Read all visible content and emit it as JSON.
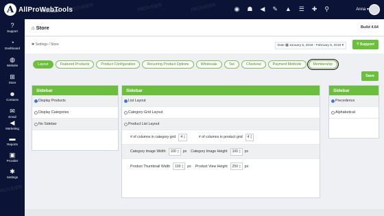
{
  "app": {
    "logo_letter": "A",
    "logo_name": "AllProWebTools",
    "logo_sub": "PROVIDER"
  },
  "watermark": "PROVIDER",
  "user": {
    "name": "Anna"
  },
  "top_icons": [
    "eye-icon",
    "users-icon",
    "megaphone-icon",
    "chat-icon",
    "alert-icon",
    "list-icon",
    "plus-icon",
    "search-icon"
  ],
  "sidebar": {
    "items": [
      {
        "label": "Support",
        "icon": "question-icon",
        "glyph": "?"
      },
      {
        "label": "Dashboard",
        "icon": "dashboard-icon",
        "glyph": "◔"
      },
      {
        "label": "Website",
        "icon": "globe-icon",
        "glyph": "◍"
      },
      {
        "label": "Store",
        "icon": "cart-icon",
        "glyph": "⊞"
      },
      {
        "label": "Contacts",
        "icon": "contacts-icon",
        "glyph": "☻"
      },
      {
        "label": "Email",
        "icon": "email-icon",
        "glyph": "✉"
      },
      {
        "label": "Marketing",
        "icon": "megaphone-icon",
        "glyph": "◀"
      },
      {
        "label": "Reports",
        "icon": "folder-icon",
        "glyph": "▬"
      },
      {
        "label": "Provider",
        "icon": "briefcase-icon",
        "glyph": "▣"
      },
      {
        "label": "Settings",
        "icon": "gear-icon",
        "glyph": "✱"
      }
    ]
  },
  "page": {
    "title": "Store",
    "build": "Build 4.64",
    "breadcrumb_settings": "Settings",
    "breadcrumb_sep": "/",
    "breadcrumb_store": "Store",
    "date_label": "Date",
    "date_range": "January 5, 2019 - February 5, 2019",
    "support_label": "Support",
    "save_label": "Save"
  },
  "tabs": [
    {
      "label": "Layout",
      "active": true
    },
    {
      "label": "Featured Products"
    },
    {
      "label": "Product Configuration"
    },
    {
      "label": "Recurring Product Options"
    },
    {
      "label": "Wholesale"
    },
    {
      "label": "Tax"
    },
    {
      "label": "Checkout"
    },
    {
      "label": "Payment Methods"
    },
    {
      "label": "Membership",
      "circled": true
    }
  ],
  "left_panel": {
    "title": "Sidebar",
    "options": [
      {
        "label": "Display Products",
        "selected": true
      },
      {
        "label": "Display Categories",
        "selected": false
      },
      {
        "label": "No Sidebar",
        "selected": false
      }
    ]
  },
  "center_panel": {
    "title": "Sidebar",
    "options": [
      {
        "label": "List Layout",
        "selected": true
      },
      {
        "label": "Category Grid Layout",
        "selected": false
      },
      {
        "label": "Product List Layout",
        "selected": false
      }
    ],
    "fields": [
      {
        "label": "# of columns in category grid",
        "value": "4",
        "label2": "# of columns in product grid",
        "value2": "4"
      },
      {
        "label": "Category Image Width",
        "value": "100",
        "unit": "px",
        "label2": "Category Image Height",
        "value2": "100",
        "unit2": "px"
      },
      {
        "label": "Product Thumbnail Width",
        "value": "100",
        "unit": "px",
        "label2": "Product View Height",
        "value2": "250",
        "unit2": "px"
      }
    ]
  },
  "right_panel": {
    "title": "Sidebar",
    "options": [
      {
        "label": "Precedence",
        "selected": true
      },
      {
        "label": "Alphabetical",
        "selected": false
      }
    ]
  },
  "colors": {
    "brand_navy": "#0b1437",
    "accent_green": "#6cbf3c",
    "radio_blue": "#3a7bd5"
  }
}
